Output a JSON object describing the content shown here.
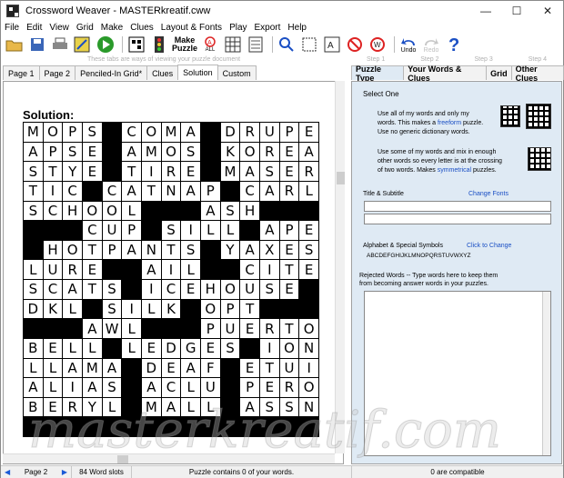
{
  "window": {
    "title": "Crossword Weaver - MASTERkreatif.cww"
  },
  "menu": [
    "File",
    "Edit",
    "View",
    "Grid",
    "Make",
    "Clues",
    "Layout & Fonts",
    "Play",
    "Export",
    "Help"
  ],
  "toolbar": {
    "make_puzzle_label_1": "Make",
    "make_puzzle_label_2": "Puzzle",
    "all_label": "ALL",
    "undo_label": "Undo",
    "redo_label": "Redo"
  },
  "tabs_hint": "These tabs are ways of viewing your puzzle document",
  "left_tabs": [
    "Page 1",
    "Page 2",
    "Penciled-In Grid*",
    "Clues",
    "Solution",
    "Custom"
  ],
  "steps": [
    "Step 1",
    "Step 2",
    "Step 3",
    "Step 4"
  ],
  "right_tabs": [
    "Puzzle Type",
    "Your Words & Clues",
    "Grid",
    "Other Clues"
  ],
  "solution_title": "Solution:",
  "grid_rows": [
    "MOPS#COMA#DRUPE",
    "APSE#AMOS#KOREA",
    "STYE#TIRE#MASER",
    "TIC#CATNAP#CARL",
    "SCHOOL###ASH###",
    "###CUP#SILL#APE",
    "#HOTPANTS#YAXES",
    "LURE##AIL##CITE",
    "SCATS#ICEHOUSE#",
    "DKL#SILK#OPT###",
    "###AWL###PUERTO",
    "BELL#LEDGES#ION",
    "LLAMA#DEAF#ETUI",
    "ALIAS#ACLU#PERO",
    "BERYL#MALL#ASSN"
  ],
  "right_panel": {
    "select_one": "Select One",
    "opt1_a": "Use all of my words and only my",
    "opt1_b": "words. This makes a ",
    "opt1_link": "freeform",
    "opt1_c": " puzzle.",
    "opt1_d": "Use no generic dictionary words.",
    "opt2_a": "Use some of my words and mix in enough",
    "opt2_b": "other words so every letter is at the crossing",
    "opt2_c": "of two words. Makes ",
    "opt2_link": "symmetrical",
    "opt2_d": " puzzles.",
    "title_subtitle": "Title & Subtitle",
    "change_fonts": "Change Fonts",
    "alphabet_label": "Alphabet & Special Symbols",
    "click_to_change": "Click to Change",
    "alphabet": "ABCDEFGHIJKLMNOPQRSTUVWXYZ",
    "rejected_a": "Rejected Words -- Type words here to keep them",
    "rejected_b": "from becoming answer words in your puzzles."
  },
  "status": {
    "page": "Page 2",
    "word_slots": "84 Word slots",
    "contains": "Puzzle contains 0 of your words.",
    "compatible": "0 are compatible"
  },
  "watermark": "masterkreatif.com"
}
